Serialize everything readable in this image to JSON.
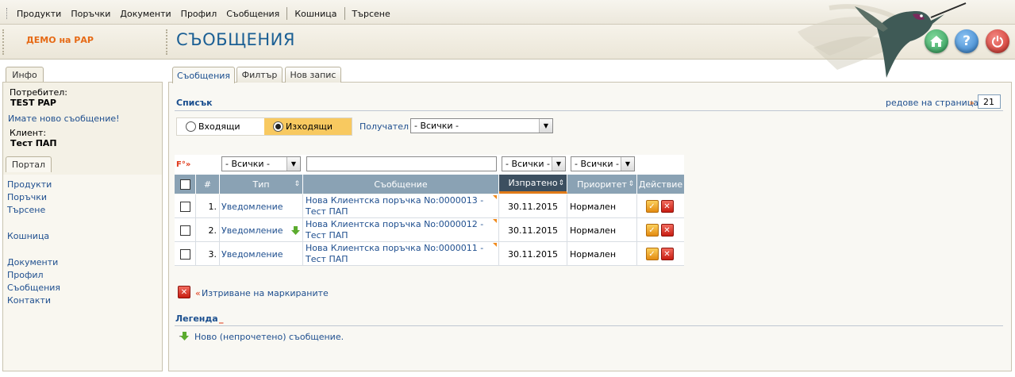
{
  "top_menu": [
    "Продукти",
    "Поръчки",
    "Документи",
    "Профил",
    "Съобщения",
    "Кошница",
    "Търсене"
  ],
  "header": {
    "company": "ДЕМО на РАР",
    "title": "СЪОБЩЕНИЯ"
  },
  "left_panel": {
    "tab_info": "Инфо",
    "user_label": "Потребител:",
    "user_name": "TEST PAP",
    "new_message": "Имате ново съобщение!",
    "client_label": "Клиент:",
    "client_name": "Тест ПАП",
    "tab_portal": "Портал",
    "links": [
      "Продукти",
      "Поръчки",
      "Търсене",
      "Кошница",
      "Документи",
      "Профил",
      "Съобщения",
      "Контакти"
    ]
  },
  "main_tabs": [
    "Съобщения",
    "Филтър",
    "Нов запис"
  ],
  "list": {
    "title": "Списък",
    "rows_per_page_label": "редове на страница",
    "rows_per_page_arrows": "»",
    "rows_per_page_value": "21",
    "radio_incoming": "Входящи",
    "radio_outgoing": "Изходящи",
    "recipient_label": "Получател",
    "recipient_value": "- Всички -"
  },
  "filters": {
    "marker": "F°»",
    "type": "- Всички -",
    "message": "",
    "sent": "- Всички -",
    "priority": "- Всички -"
  },
  "columns": [
    "#",
    "Тип",
    "Съобщение",
    "Изпратено",
    "Приоритет",
    "Действие"
  ],
  "rows": [
    {
      "num": "1.",
      "type": "Уведомление",
      "message": "Нова Клиентска поръчка No:0000013 - Тест ПАП",
      "sent": "30.11.2015",
      "priority": "Нормален",
      "new": false
    },
    {
      "num": "2.",
      "type": "Уведомление",
      "message": "Нова Клиентска поръчка No:0000012 - Тест ПАП",
      "sent": "30.11.2015",
      "priority": "Нормален",
      "new": true
    },
    {
      "num": "3.",
      "type": "Уведомление",
      "message": "Нова Клиентска поръчка No:0000011 - Тест ПАП",
      "sent": "30.11.2015",
      "priority": "Нормален",
      "new": false
    }
  ],
  "delete_marked": {
    "arrows": "«",
    "label": "Изтриване на маркираните"
  },
  "legend": {
    "title": "Легенда",
    "title_suffix": "_",
    "new_message": "Ново (непрочетено) съобщение.",
    "prefix": "_"
  },
  "colors": {
    "accent_blue": "#1b4f8f",
    "orange": "#e66a16",
    "header_col": "#8aa2b4",
    "sorted_col": "#3c4f60"
  }
}
